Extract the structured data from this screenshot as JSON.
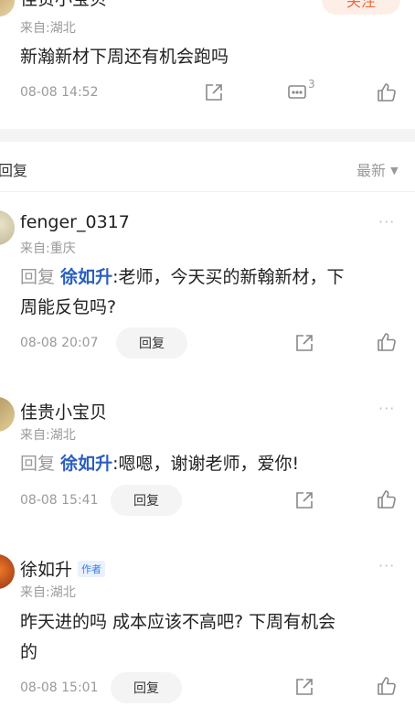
{
  "top_post": {
    "author": "佳贵小宝贝",
    "location": "来自:湖北",
    "follow_label": "关注",
    "content": "新瀚新材下周还有机会跑吗",
    "time": "08-08 14:52",
    "comment_count": "3"
  },
  "replies_header": {
    "title": "回复",
    "sort_label": "最新"
  },
  "comments": [
    {
      "author": "fenger_0317",
      "location": "来自:重庆",
      "reply_prefix": "回复",
      "mention": "徐如升",
      "content_line1": ":老师，今天买的新翰新材，下",
      "content_line2": "周能反包吗?",
      "time": "08-08 20:07",
      "reply_label": "回复"
    },
    {
      "author": "佳贵小宝贝",
      "location": "来自:湖北",
      "reply_prefix": "回复",
      "mention": "徐如升",
      "content_line1": ":嗯嗯，谢谢老师，爱你!",
      "time": "08-08 15:41",
      "reply_label": "回复"
    },
    {
      "author": "徐如升",
      "author_tag": "作者",
      "location": "来自:湖北",
      "content_line1": "昨天进的吗 成本应该不高吧? 下周有机会",
      "content_line2": "的",
      "time": "08-08 15:01",
      "reply_label": "回复"
    }
  ],
  "more_glyph": "···",
  "sort_arrow": "▼",
  "colors": {
    "accent_blue": "#2a5fbf",
    "follow_orange": "#f06a3a",
    "muted_gray": "#9a9a9a"
  },
  "icons": [
    "share-icon",
    "comment-icon",
    "like-icon",
    "more-icon",
    "chevron-down-icon"
  ]
}
